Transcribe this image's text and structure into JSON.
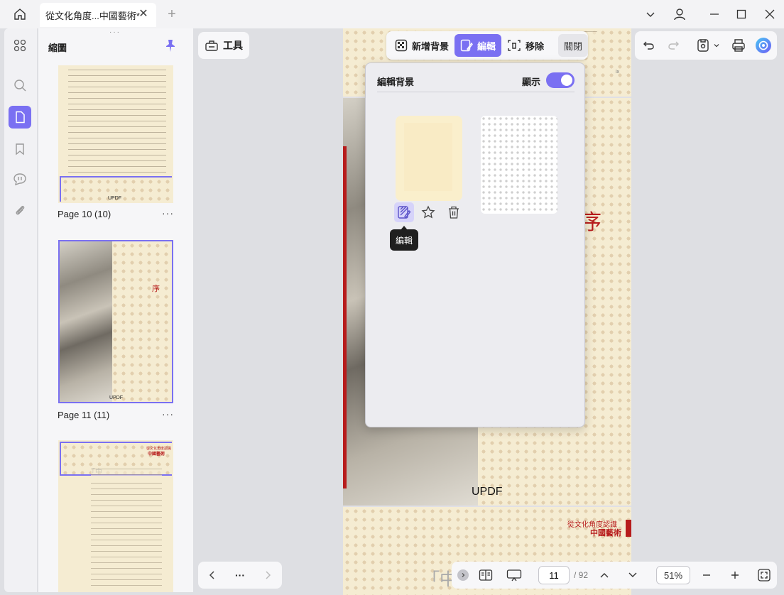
{
  "tab": {
    "title": "從文化角度...中國藝術*"
  },
  "thumbnails": {
    "title": "縮圖",
    "pages": [
      {
        "label": "Page 10 (10)",
        "footer": "UPDF"
      },
      {
        "label": "Page 11 (11)",
        "footer": "UPDF",
        "heading": "序"
      },
      {
        "label": "",
        "subtitle": "從文化角度認識",
        "title": "中國藝術",
        "big_char": "「中"
      }
    ]
  },
  "toolbar": {
    "tools_label": "工具"
  },
  "background_toolbar": {
    "add_label": "新增背景",
    "edit_label": "編輯",
    "remove_label": "移除",
    "close_label": "關閉"
  },
  "popover": {
    "title": "編輯背景",
    "show_label": "顯示",
    "show_enabled": true,
    "tooltip": "編輯"
  },
  "page_content": {
    "heading": "序",
    "footer": "UPDF",
    "next_subtitle": "從文化角度認識",
    "next_title": "中國藝術",
    "next_big_char": "「中",
    "roman_numeral": "ix"
  },
  "page_nav": {
    "more": "···",
    "current_page": "11",
    "total_pages": "/ 92",
    "zoom": "51%"
  },
  "colors": {
    "accent": "#7a70f2",
    "red": "#b71c1c",
    "paper": "#f5ecd2"
  }
}
